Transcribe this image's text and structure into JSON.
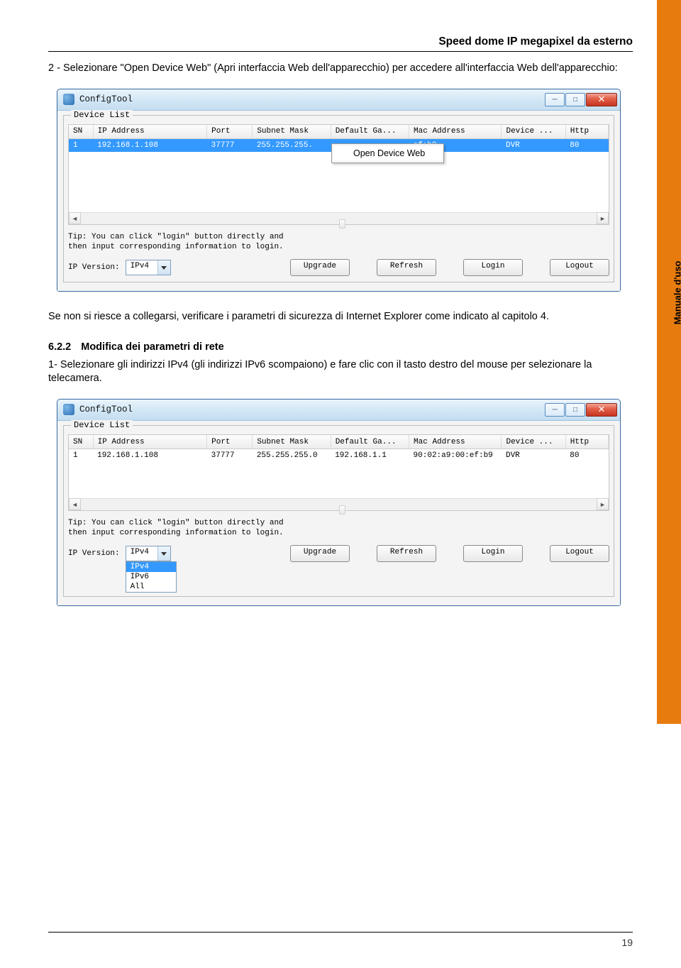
{
  "header": {
    "title": "Speed dome IP megapixel da esterno"
  },
  "sidebar": {
    "label": "Manuale d'uso"
  },
  "intro": {
    "p1": "2 - Selezionare \"Open Device Web\" (Apri interfaccia Web dell'apparecchio) per accedere all'interfaccia Web dell'apparecchio:"
  },
  "win1": {
    "title": "ConfigTool",
    "legend": "Device List",
    "headers": [
      "SN",
      "IP Address",
      "Port",
      "Subnet Mask",
      "Default Ga...",
      "Mac Address",
      "Device ...",
      "Http"
    ],
    "row": {
      "sn": "1",
      "ip": "192.168.1.108",
      "port": "37777",
      "mask": "255.255.255.",
      "gw": "",
      "mac": "ef:b9",
      "dev": "DVR",
      "http": "80"
    },
    "context_item": "Open Device Web",
    "tip1": "Tip: You can click \"login\" button directly and",
    "tip2": "then input corresponding information to login.",
    "ip_version_label": "IP Version:",
    "ip_version_value": "IPv4",
    "buttons": {
      "upgrade": "Upgrade",
      "refresh": "Refresh",
      "login": "Login",
      "logout": "Logout"
    }
  },
  "mid": {
    "p1": "Se non si riesce a collegarsi, verificare i parametri di sicurezza di Internet Explorer come indicato al capitolo 4."
  },
  "section": {
    "num": "6.2.2",
    "title": "Modifica dei parametri di rete"
  },
  "step1": "1- Selezionare gli indirizzi IPv4 (gli indirizzi IPv6 scompaiono) e fare clic con il tasto destro del mouse per selezionare la telecamera.",
  "win2": {
    "title": "ConfigTool",
    "legend": "Device List",
    "headers": [
      "SN",
      "IP Address",
      "Port",
      "Subnet Mask",
      "Default Ga...",
      "Mac Address",
      "Device ...",
      "Http"
    ],
    "row": {
      "sn": "1",
      "ip": "192.168.1.108",
      "port": "37777",
      "mask": "255.255.255.0",
      "gw": "192.168.1.1",
      "mac": "90:02:a9:00:ef:b9",
      "dev": "DVR",
      "http": "80"
    },
    "tip1": "Tip: You can click \"login\" button directly and",
    "tip2": "then input corresponding information to login.",
    "ip_version_label": "IP Version:",
    "ip_version_value": "IPv4",
    "options": [
      "IPv4",
      "IPv6",
      "All"
    ],
    "buttons": {
      "upgrade": "Upgrade",
      "refresh": "Refresh",
      "login": "Login",
      "logout": "Logout"
    }
  },
  "footer": {
    "page": "19"
  }
}
